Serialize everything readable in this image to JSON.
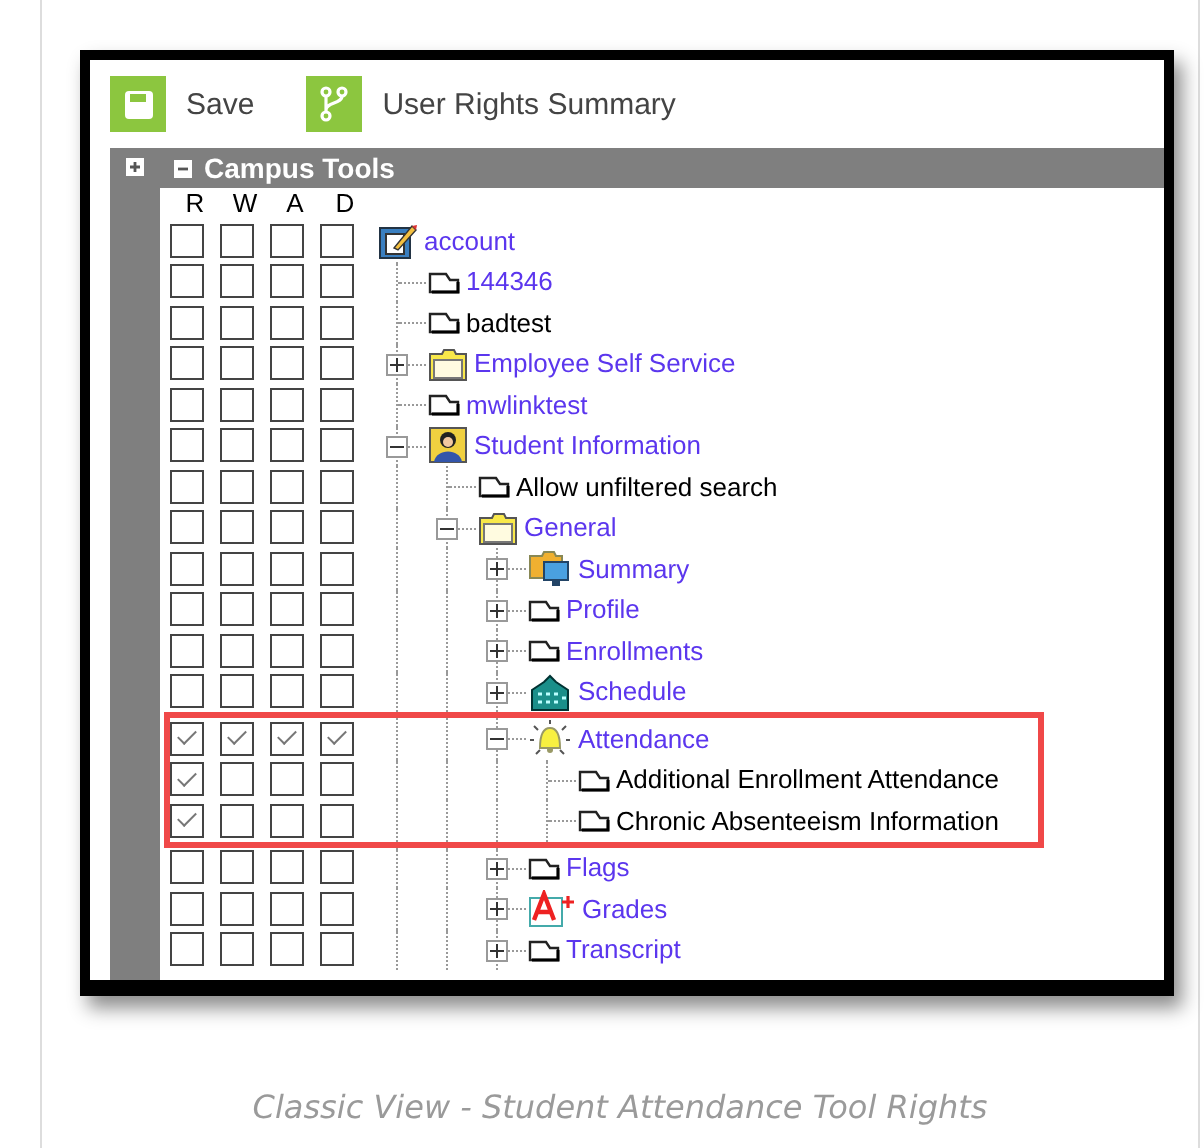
{
  "toolbar": {
    "buttons": [
      {
        "kind": "save",
        "label": "Save"
      },
      {
        "kind": "summary",
        "label": "User Rights Summary"
      }
    ]
  },
  "panel": {
    "title": "Campus Tools",
    "expanded": true,
    "columns": [
      "R",
      "W",
      "A",
      "D"
    ]
  },
  "tree": [
    {
      "label": "account",
      "kind": "notepad",
      "link": true,
      "highlighted": false,
      "rights": [
        {
          "checked": false
        },
        {
          "checked": false
        },
        {
          "checked": false
        },
        {
          "checked": false
        }
      ],
      "children": [
        {
          "label": "144346",
          "kind": "document",
          "link": true,
          "highlighted": false,
          "rights": [
            {
              "checked": false
            },
            {
              "checked": false
            },
            {
              "checked": false
            },
            {
              "checked": false
            }
          ]
        },
        {
          "label": "badtest",
          "kind": "document",
          "link": false,
          "highlighted": false,
          "rights": [
            {
              "checked": false
            },
            {
              "checked": false
            },
            {
              "checked": false
            },
            {
              "checked": false
            }
          ]
        },
        {
          "label": "Employee Self Service",
          "kind": "folder",
          "link": true,
          "expanded": false,
          "highlighted": false,
          "rights": [
            {
              "checked": false
            },
            {
              "checked": false
            },
            {
              "checked": false
            },
            {
              "checked": false
            }
          ]
        },
        {
          "label": "mwlinktest",
          "kind": "document",
          "link": true,
          "highlighted": false,
          "rights": [
            {
              "checked": false
            },
            {
              "checked": false
            },
            {
              "checked": false
            },
            {
              "checked": false
            }
          ]
        },
        {
          "label": "Student Information",
          "kind": "person",
          "link": true,
          "expanded": true,
          "highlighted": false,
          "rights": [
            {
              "checked": false
            },
            {
              "checked": false
            },
            {
              "checked": false
            },
            {
              "checked": false
            }
          ],
          "children": [
            {
              "label": "Allow unfiltered search",
              "kind": "document",
              "link": false,
              "highlighted": false,
              "rights": [
                {
                  "checked": false
                },
                {
                  "checked": false
                },
                {
                  "checked": false
                },
                {
                  "checked": false
                }
              ]
            },
            {
              "label": "General",
              "kind": "folder",
              "link": true,
              "expanded": true,
              "highlighted": false,
              "rights": [
                {
                  "checked": false
                },
                {
                  "checked": false
                },
                {
                  "checked": false
                },
                {
                  "checked": false
                }
              ],
              "children": [
                {
                  "label": "Summary",
                  "kind": "computer",
                  "link": true,
                  "expanded": false,
                  "highlighted": false,
                  "rights": [
                    {
                      "checked": false
                    },
                    {
                      "checked": false
                    },
                    {
                      "checked": false
                    },
                    {
                      "checked": false
                    }
                  ]
                },
                {
                  "label": "Profile",
                  "kind": "document",
                  "link": true,
                  "expanded": false,
                  "highlighted": false,
                  "rights": [
                    {
                      "checked": false
                    },
                    {
                      "checked": false
                    },
                    {
                      "checked": false
                    },
                    {
                      "checked": false
                    }
                  ]
                },
                {
                  "label": "Enrollments",
                  "kind": "document",
                  "link": true,
                  "expanded": false,
                  "highlighted": false,
                  "rights": [
                    {
                      "checked": false
                    },
                    {
                      "checked": false
                    },
                    {
                      "checked": false
                    },
                    {
                      "checked": false
                    }
                  ]
                },
                {
                  "label": "Schedule",
                  "kind": "building",
                  "link": true,
                  "expanded": false,
                  "highlighted": false,
                  "rights": [
                    {
                      "checked": false
                    },
                    {
                      "checked": false
                    },
                    {
                      "checked": false
                    },
                    {
                      "checked": false
                    }
                  ]
                },
                {
                  "label": "Attendance",
                  "kind": "bell",
                  "link": true,
                  "expanded": true,
                  "highlighted": true,
                  "rights": [
                    {
                      "checked": true
                    },
                    {
                      "checked": true
                    },
                    {
                      "checked": true
                    },
                    {
                      "checked": true
                    }
                  ],
                  "children": [
                    {
                      "label": "Additional Enrollment Attendance",
                      "kind": "document",
                      "link": false,
                      "highlighted": true,
                      "rights": [
                        {
                          "checked": true
                        },
                        {
                          "checked": false
                        },
                        {
                          "checked": false
                        },
                        {
                          "checked": false
                        }
                      ]
                    },
                    {
                      "label": "Chronic Absenteeism Information",
                      "kind": "document",
                      "link": false,
                      "highlighted": true,
                      "rights": [
                        {
                          "checked": true
                        },
                        {
                          "checked": false
                        },
                        {
                          "checked": false
                        },
                        {
                          "checked": false
                        }
                      ]
                    }
                  ]
                },
                {
                  "label": "Flags",
                  "kind": "document",
                  "link": true,
                  "expanded": false,
                  "highlighted": false,
                  "rights": [
                    {
                      "checked": false
                    },
                    {
                      "checked": false
                    },
                    {
                      "checked": false
                    },
                    {
                      "checked": false
                    }
                  ]
                },
                {
                  "label": "Grades",
                  "kind": "grade",
                  "link": true,
                  "expanded": false,
                  "highlighted": false,
                  "rights": [
                    {
                      "checked": false
                    },
                    {
                      "checked": false
                    },
                    {
                      "checked": false
                    },
                    {
                      "checked": false
                    }
                  ]
                },
                {
                  "label": "Transcript",
                  "kind": "document",
                  "link": true,
                  "expanded": false,
                  "highlighted": false,
                  "rights": [
                    {
                      "checked": false
                    },
                    {
                      "checked": false
                    },
                    {
                      "checked": false
                    },
                    {
                      "checked": false
                    }
                  ]
                }
              ]
            }
          ]
        }
      ]
    }
  ],
  "caption": "Classic View - Student Attendance Tool Rights"
}
